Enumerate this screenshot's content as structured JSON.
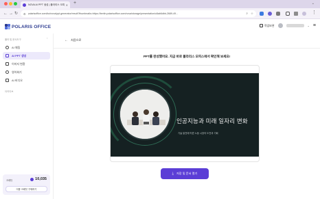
{
  "browser": {
    "tab_title": "NOVA AI PPT 생성 | 폴라리스 오피스",
    "url": "polarisoffice.com/ko/nova/ppt-generator/result?thumbnails=https://berlin.polarisoffice.com/nova/storage/presentation/c8ab6dbb-2689-49..."
  },
  "app": {
    "logo_text": "POLARIS OFFICE",
    "my_docs_label": "작업보관",
    "accent_color": "#5b3ed6"
  },
  "sidebar": {
    "section1_label": "폴라 및 문서도구",
    "items": [
      {
        "label": "AI 채팅",
        "icon": "chat-icon"
      },
      {
        "label": "AI PPT 생성",
        "icon": "presentation-icon"
      },
      {
        "label": "이미지 변환",
        "icon": "image-icon"
      },
      {
        "label": "영어회기",
        "icon": "translate-icon"
      },
      {
        "label": "AI 비디오",
        "icon": "video-icon"
      }
    ],
    "section2_label": "아카이브",
    "credit": {
      "label": "크레딧",
      "value": "10,035",
      "buy_label": "이용 크레딧 구매하기"
    }
  },
  "main": {
    "back_label": "처음으로",
    "notice": "PPT를 완성했어요. 지금 바로 폴라리스 오피스에서 확인해 보세요!",
    "slide": {
      "title": "인공지능과 미래 일자리 변화",
      "subtitle": "기술 발전에 따른 노동 시장의 도전과 기회"
    },
    "download_label": "저장 및 문서 열기"
  }
}
